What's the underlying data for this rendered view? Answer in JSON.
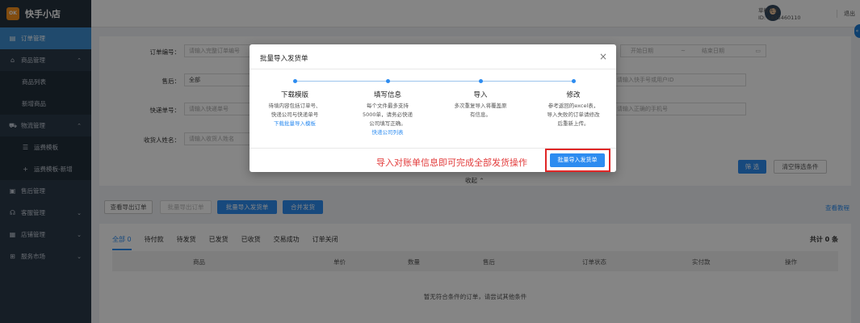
{
  "app": {
    "logo_mark": "OK",
    "name": "快手小店"
  },
  "header": {
    "user_name": "草料先生",
    "user_id": "ID: 1433460110",
    "logout": "退出"
  },
  "sidebar": {
    "items": [
      {
        "label": "订单管理",
        "icon": "doc-icon",
        "active": true
      },
      {
        "label": "商品管理",
        "icon": "bag-icon",
        "chev": "⌃"
      },
      {
        "label": "商品列表",
        "sub": true
      },
      {
        "label": "新增商品",
        "sub": true
      },
      {
        "label": "物流管理",
        "icon": "truck-icon",
        "chev": "⌃"
      },
      {
        "label": "运费模板",
        "sub": true,
        "glyph": "☰"
      },
      {
        "label": "运费模板-新增",
        "sub": true,
        "glyph": "+"
      },
      {
        "label": "售后管理",
        "icon": "service-icon"
      },
      {
        "label": "客服管理",
        "icon": "headset-icon",
        "chev": "⌄"
      },
      {
        "label": "店铺管理",
        "icon": "shop-icon",
        "chev": "⌄"
      },
      {
        "label": "服务市场",
        "icon": "grid-icon",
        "chev": "⌄"
      }
    ]
  },
  "filter": {
    "order_no_label": "订单编号：",
    "order_no_placeholder": "请输入完整订单编号",
    "aftersale_label": "售后：",
    "aftersale_value": "全部",
    "express_label": "快递单号：",
    "express_placeholder": "请输入快递单号",
    "receiver_label": "收货人姓名：",
    "receiver_placeholder": "请输入收货人姓名",
    "start_date": "开始日期",
    "date_sep": "~",
    "end_date": "结束日期",
    "kuaishou_id_placeholder": "请输入快手号或用户ID",
    "phone_placeholder": "请输入正确的手机号",
    "search_btn": "筛 选",
    "clear_btn": "清空筛选条件",
    "collapse": "收起"
  },
  "actions": {
    "view_export": "查看导出订单",
    "batch_export": "批量导出订单",
    "batch_import": "批量导入发货单",
    "merge_ship": "合并发货",
    "guide": "查看教程"
  },
  "orders": {
    "tabs": [
      "全部 0",
      "待付款",
      "待发货",
      "已发货",
      "已收货",
      "交易成功",
      "订单关闭"
    ],
    "total": "共计 0 条",
    "columns": [
      "商品",
      "单价",
      "数量",
      "售后",
      "订单状态",
      "实付款",
      "操作"
    ],
    "empty": "暂无符合条件的订单，请尝试其他条件"
  },
  "modal": {
    "title": "批量导入发货单",
    "close": "×",
    "steps": [
      {
        "title": "下载模版",
        "desc": [
          "待填内容包括订单号、",
          "快递公司与快递单号"
        ],
        "link": "下载批量导入模板"
      },
      {
        "title": "填写信息",
        "desc": [
          "每个文件最多支持",
          "5000单，请务必快递",
          "公司填写正确。"
        ],
        "link": "快递公司列表"
      },
      {
        "title": "导入",
        "desc": [
          "多次重复导入将覆盖原",
          "有信息。"
        ],
        "link": ""
      },
      {
        "title": "修改",
        "desc": [
          "参考返回的excel表，",
          "导入失败的订单请修改",
          "后重新上传。"
        ],
        "link": ""
      }
    ],
    "hint": "导入对账单信息即可完成全部发货操作",
    "import_btn": "批量导入发货单"
  }
}
